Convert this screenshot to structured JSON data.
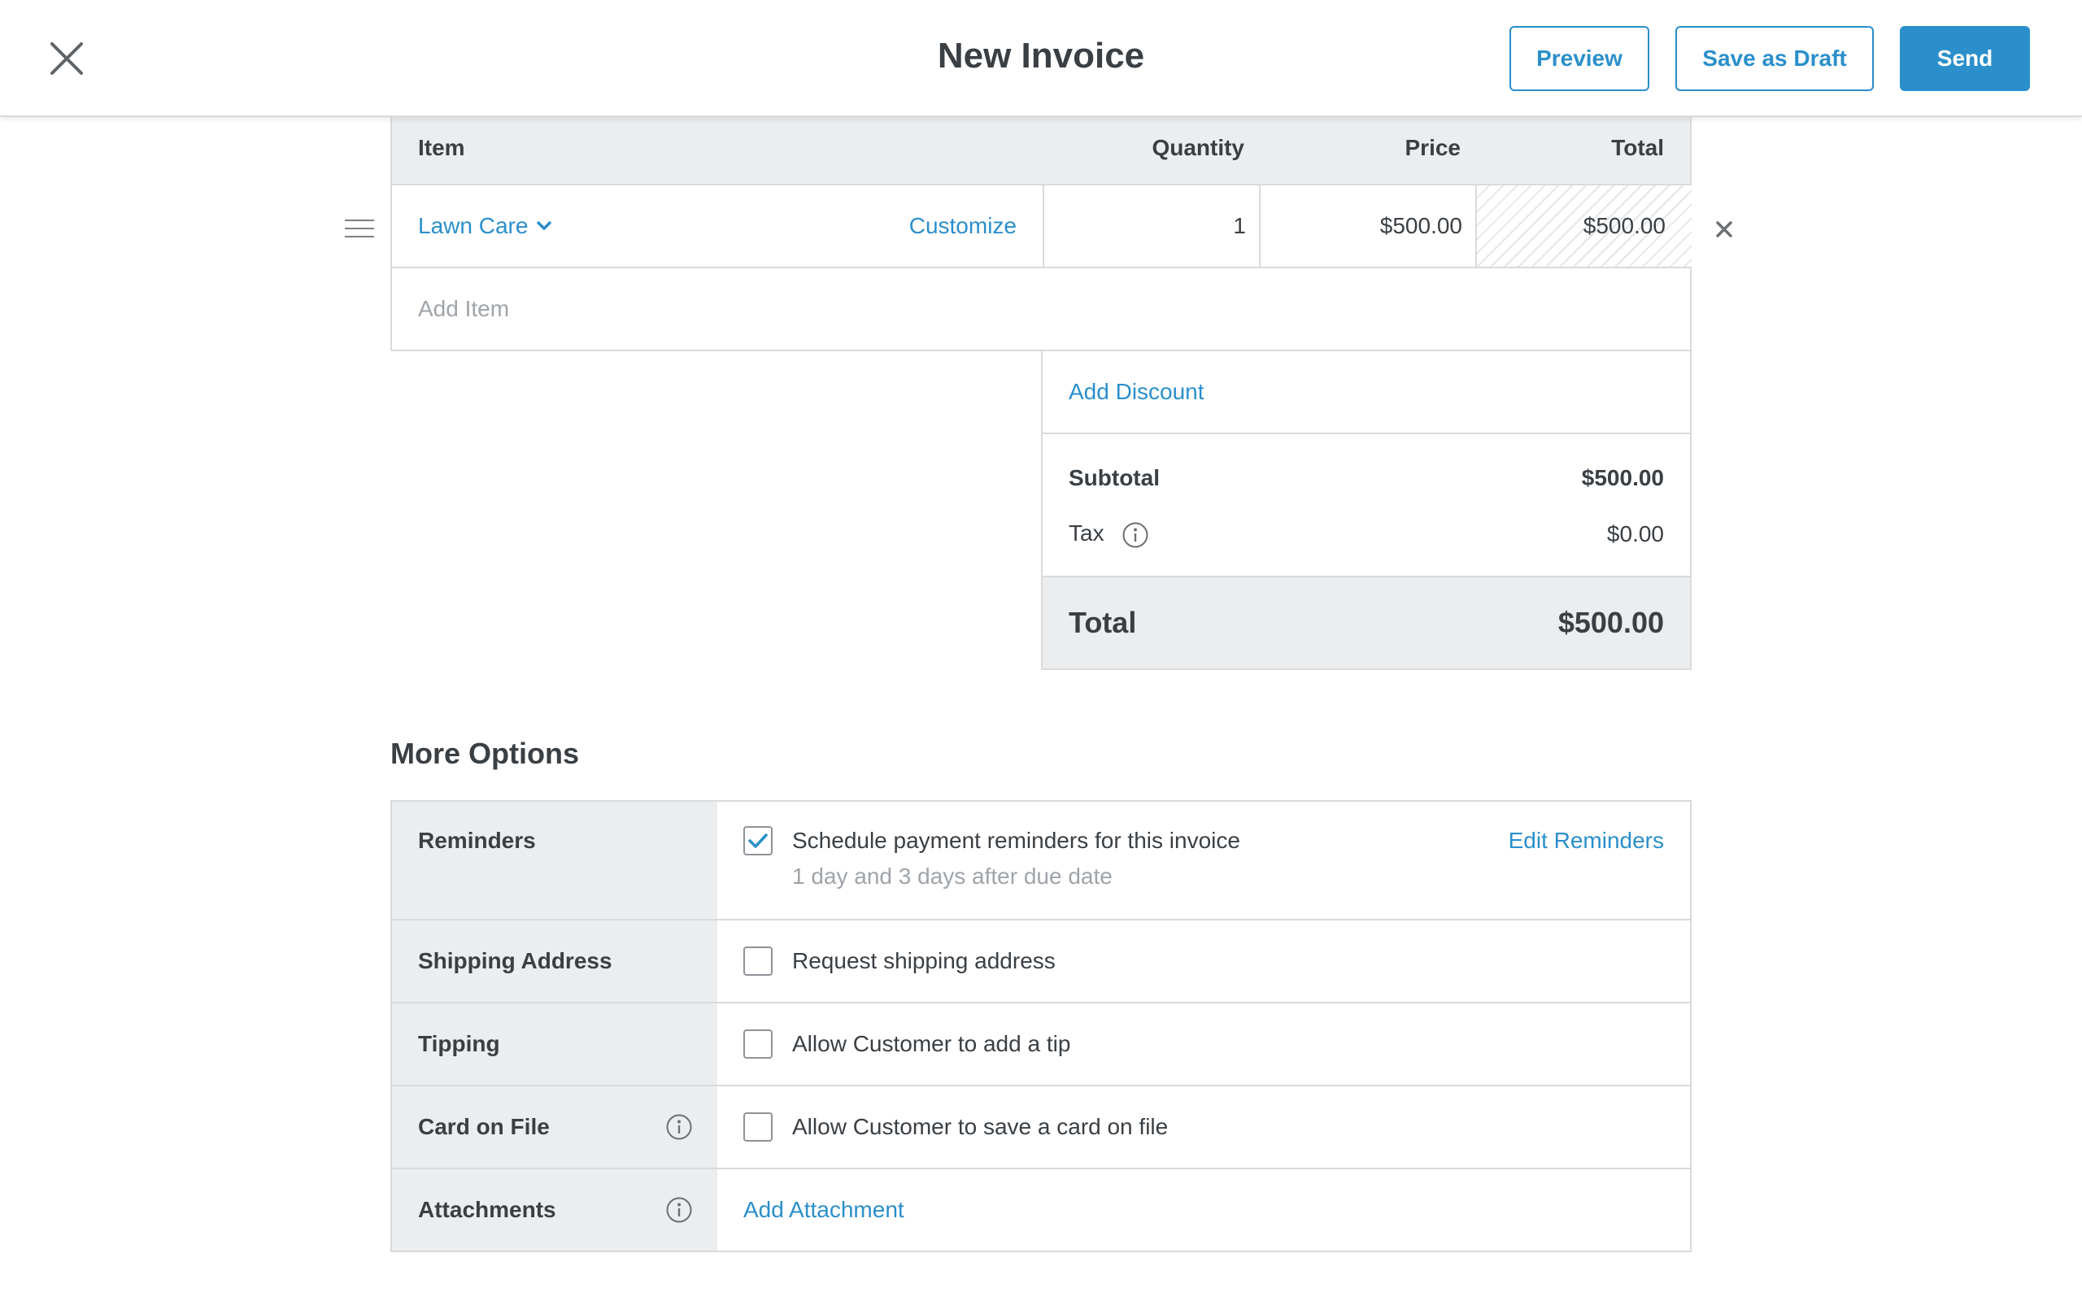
{
  "header": {
    "title": "New Invoice",
    "preview_label": "Preview",
    "save_draft_label": "Save as Draft",
    "send_label": "Send"
  },
  "items_table": {
    "columns": {
      "item": "Item",
      "quantity": "Quantity",
      "price": "Price",
      "total": "Total"
    },
    "rows": [
      {
        "name": "Lawn Care",
        "customize_label": "Customize",
        "quantity": "1",
        "price": "$500.00",
        "total": "$500.00"
      }
    ],
    "add_item_placeholder": "Add Item"
  },
  "totals": {
    "add_discount_label": "Add Discount",
    "subtotal_label": "Subtotal",
    "subtotal_value": "$500.00",
    "tax_label": "Tax",
    "tax_value": "$0.00",
    "total_label": "Total",
    "total_value": "$500.00"
  },
  "more_options": {
    "title": "More Options",
    "reminders": {
      "label": "Reminders",
      "checkbox_label": "Schedule payment reminders for this invoice",
      "checked": true,
      "subtext": "1 day and 3 days after due date",
      "edit_label": "Edit Reminders"
    },
    "shipping": {
      "label": "Shipping Address",
      "checkbox_label": "Request shipping address",
      "checked": false
    },
    "tipping": {
      "label": "Tipping",
      "checkbox_label": "Allow Customer to add a tip",
      "checked": false
    },
    "card_on_file": {
      "label": "Card on File",
      "checkbox_label": "Allow Customer to save a card on file",
      "checked": false
    },
    "attachments": {
      "label": "Attachments",
      "add_label": "Add Attachment"
    }
  },
  "colors": {
    "accent": "#2b8fcb",
    "text": "#3a3f44",
    "muted": "#9fa4a9",
    "panel": "#ebedef",
    "border": "#d8dadc"
  },
  "icons": [
    "close-icon",
    "chevron-down-icon",
    "drag-handle-icon",
    "remove-icon",
    "info-icon",
    "checkmark-icon"
  ]
}
